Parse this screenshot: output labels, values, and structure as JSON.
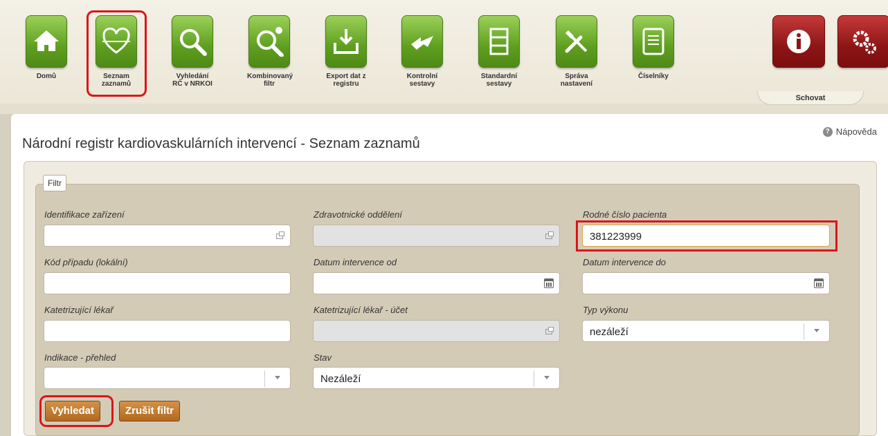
{
  "toolbar": {
    "items": [
      {
        "label": "Domů"
      },
      {
        "label": "Seznam zaznamů"
      },
      {
        "label": "Vyhledání RČ v NRKOI"
      },
      {
        "label": "Kombinovaný filtr"
      },
      {
        "label": "Export dat z registru"
      },
      {
        "label": "Kontrolní sestavy"
      },
      {
        "label": "Standardní sestavy"
      },
      {
        "label": "Správa nastavení"
      },
      {
        "label": "Číselníky"
      }
    ],
    "hide_label": "Schovat"
  },
  "page": {
    "title": "Národní registr kardiovaskulárních intervencí - Seznam zaznamů",
    "help_label": "Nápověda"
  },
  "filter": {
    "legend": "Filtr",
    "fields": {
      "identifikace": {
        "label": "Identifikace zařízení",
        "value": ""
      },
      "oddeleni": {
        "label": "Zdravotnické oddělení",
        "value": ""
      },
      "rodne_cislo": {
        "label": "Rodné číslo pacienta",
        "value": "381223999"
      },
      "kod_pripadu": {
        "label": "Kód případu (lokální)",
        "value": ""
      },
      "datum_od": {
        "label": "Datum intervence od",
        "value": ""
      },
      "datum_do": {
        "label": "Datum intervence do",
        "value": ""
      },
      "lekar": {
        "label": "Katetrizující lékař",
        "value": ""
      },
      "lekar_ucet": {
        "label": "Katetrizující lékař - účet",
        "value": ""
      },
      "typ_vykonu": {
        "label": "Typ výkonu",
        "value": "nezáleží"
      },
      "indikace": {
        "label": "Indikace - přehled",
        "value": ""
      },
      "stav": {
        "label": "Stav",
        "value": "Nezáleží"
      }
    },
    "buttons": {
      "search": "Vyhledat",
      "clear": "Zrušit filtr"
    }
  },
  "colors": {
    "toolbar_green": "#5f9f1f",
    "toolbar_red": "#8e1515",
    "highlight_red": "#d8161a",
    "button_brown": "#b06a20"
  }
}
